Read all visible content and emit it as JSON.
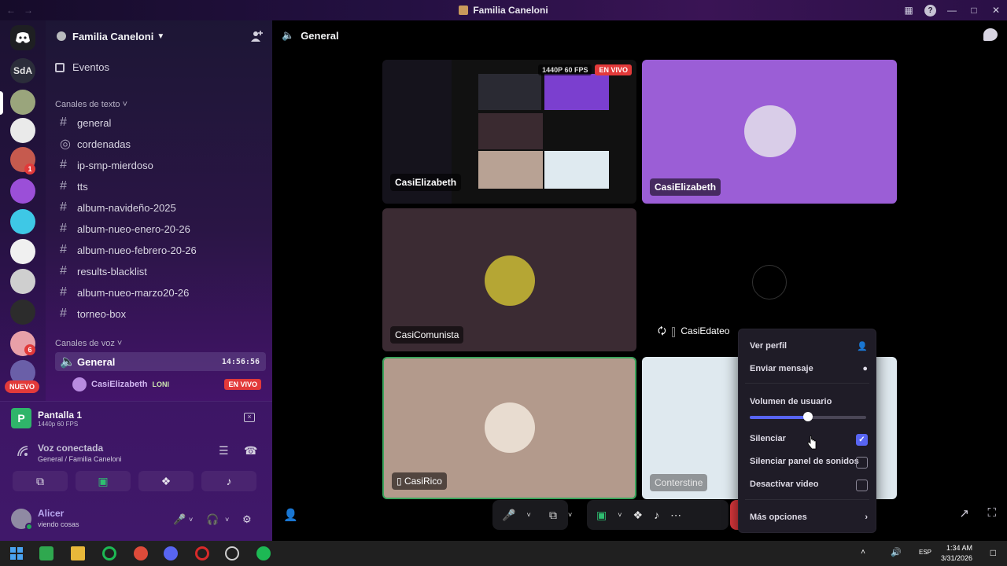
{
  "window": {
    "title": "Familia Caneloni",
    "back_icon": "←",
    "fwd_icon": "→",
    "help_label": "?"
  },
  "rail": {
    "home_label": "SdA",
    "nuevo_label": "NUEVO",
    "badges": [
      "1",
      "6"
    ]
  },
  "guild": {
    "name": "Familia Caneloni",
    "events_label": "Eventos"
  },
  "text_category": "Canales de texto",
  "text_channels": [
    "general",
    "cordenadas",
    "ip-smp-mierdoso",
    "tts",
    "album-navideño-2025",
    "album-nueo-enero-20-26",
    "album-nueo-febrero-20-26",
    "results-blacklist",
    "album-nueo-marzo20-26",
    "torneo-box"
  ],
  "voice_category": "Canales de voz",
  "voice_channel": {
    "name": "General",
    "timer": "14:56:56"
  },
  "voice_member": {
    "name": "CasiElizabeth",
    "tag": "LONI",
    "live": "EN VIVO"
  },
  "stream_panel": {
    "title": "Pantalla 1",
    "quality": "1440p 60 FPS"
  },
  "voice_status": {
    "title": "Voz conectada",
    "subtitle": "General / Familia Caneloni"
  },
  "user": {
    "name": "Alicer",
    "status": "viendo cosas"
  },
  "main": {
    "channel": "General"
  },
  "tiles": {
    "stream": {
      "label": "CasiElizabeth",
      "quality": "1440P 60 FPS",
      "live": "EN VIVO"
    },
    "elizabeth": {
      "label": "CasiElizabeth"
    },
    "comunista": {
      "label": "CasiComunista"
    },
    "edateo": {
      "label": "CasiEdateo"
    },
    "rico": {
      "label": "CasiRico"
    },
    "conterstine": {
      "label": "Conterstine"
    }
  },
  "context_menu": {
    "ver_perfil": "Ver perfil",
    "enviar_mensaje": "Enviar mensaje",
    "volumen": "Volumen de usuario",
    "volume_level": 0.5,
    "silenciar": "Silenciar",
    "silenciar_checked": true,
    "silenciar_sonidos": "Silenciar panel de sonidos",
    "desactivar_video": "Desactivar video",
    "mas_opciones": "Más opciones"
  },
  "taskbar": {
    "lang": "ESP",
    "time": "1:34 AM",
    "date": "3/31/2026"
  },
  "colors": {
    "accent": "#5865f2",
    "live": "#e23a3a",
    "online": "#23a55a",
    "speaking": "#3ba55c"
  }
}
